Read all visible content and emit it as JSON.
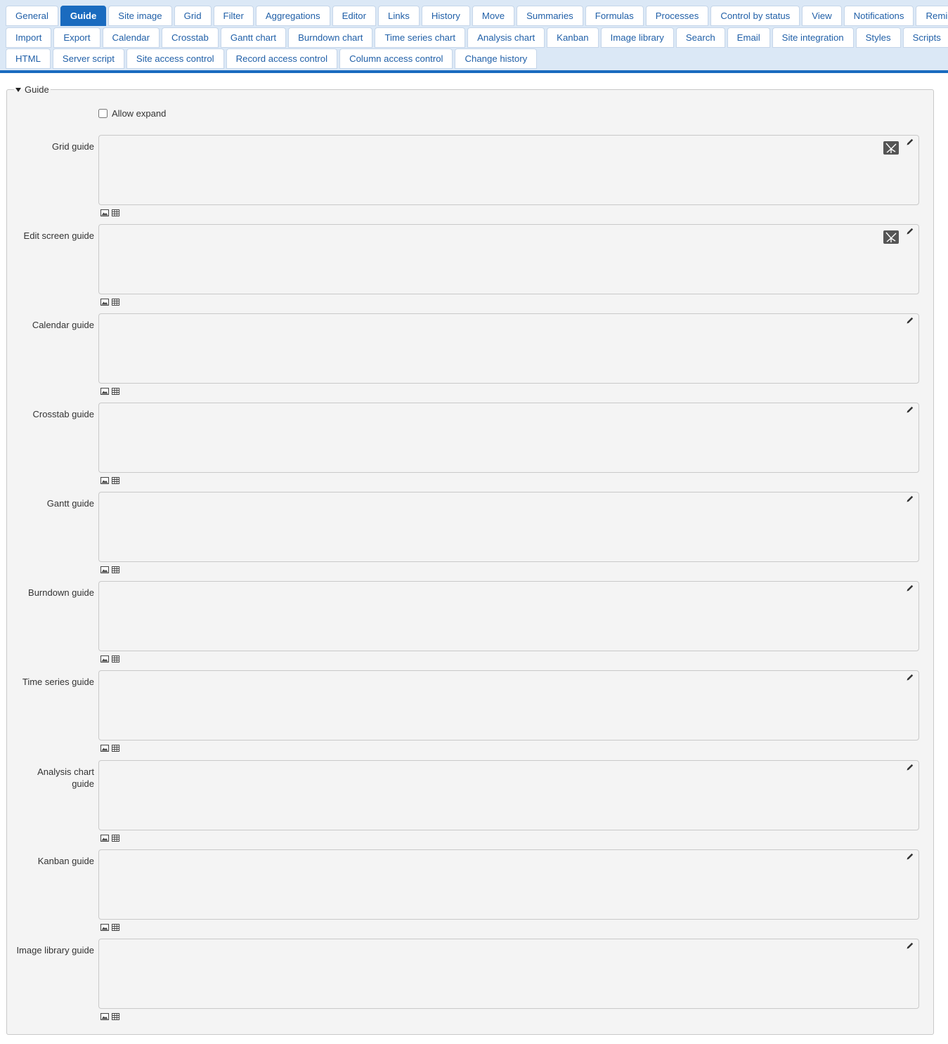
{
  "tabs": {
    "row1": [
      "General",
      "Guide",
      "Site image",
      "Grid",
      "Filter",
      "Aggregations",
      "Editor",
      "Links",
      "History",
      "Move",
      "Summaries",
      "Formulas",
      "Processes",
      "Control by status",
      "View",
      "Notifications",
      "Reminders"
    ],
    "row2": [
      "Import",
      "Export",
      "Calendar",
      "Crosstab",
      "Gantt chart",
      "Burndown chart",
      "Time series chart",
      "Analysis chart",
      "Kanban",
      "Image library",
      "Search",
      "Email",
      "Site integration",
      "Styles",
      "Scripts"
    ],
    "row3": [
      "HTML",
      "Server script",
      "Site access control",
      "Record access control",
      "Column access control",
      "Change history"
    ],
    "active": "Guide"
  },
  "guide": {
    "legend": "Guide",
    "allow_expand_label": "Allow expand",
    "allow_expand_checked": false,
    "fields": [
      {
        "label": "Grid guide",
        "value": ""
      },
      {
        "label": "Edit screen guide",
        "value": ""
      },
      {
        "label": "Calendar guide",
        "value": ""
      },
      {
        "label": "Crosstab guide",
        "value": ""
      },
      {
        "label": "Gantt guide",
        "value": ""
      },
      {
        "label": "Burndown guide",
        "value": ""
      },
      {
        "label": "Time series guide",
        "value": ""
      },
      {
        "label": "Analysis chart guide",
        "value": ""
      },
      {
        "label": "Kanban guide",
        "value": ""
      },
      {
        "label": "Image library guide",
        "value": ""
      }
    ]
  },
  "icons": {
    "edit": "pencil-icon",
    "resize": "expand-icon",
    "image": "image-icon",
    "table": "table-icon"
  },
  "colors": {
    "accent": "#1a6bbf",
    "tab_text": "#2160a8",
    "tabbar_bg": "#dbe8f6",
    "panel_bg": "#f4f4f4"
  }
}
